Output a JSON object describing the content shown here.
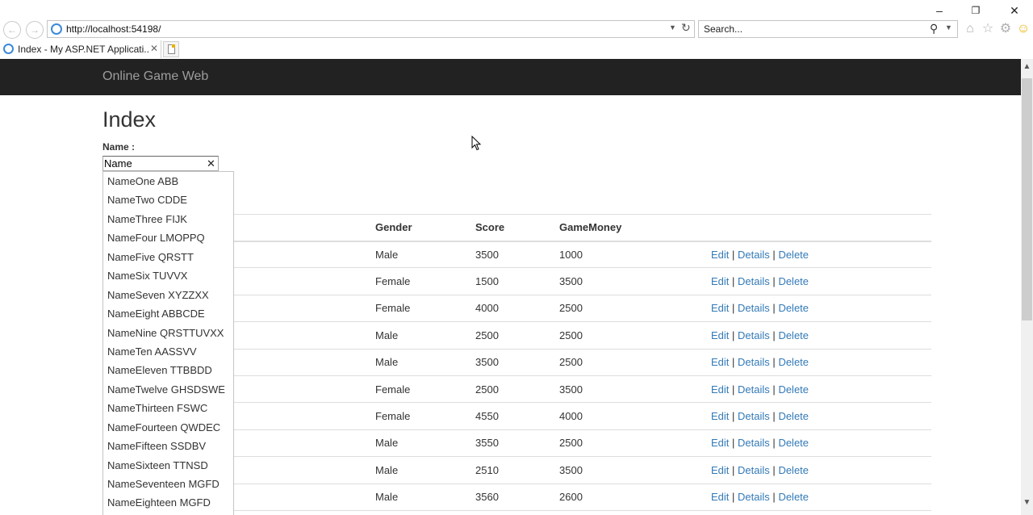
{
  "browser": {
    "url": "http://localhost:54198/",
    "search_placeholder": "Search...",
    "tab_title": "Index - My ASP.NET Applicati...",
    "window_controls": [
      "minimize-icon",
      "restore-icon",
      "close-icon"
    ],
    "toolbar_icons": [
      "home-icon",
      "favorites-star-icon",
      "settings-gear-icon",
      "feedback-smiley-icon"
    ]
  },
  "site": {
    "brand": "Online Game Web"
  },
  "page": {
    "title": "Index",
    "name_label": "Name :",
    "name_value": "Name"
  },
  "autocomplete": [
    "NameOne ABB",
    "NameTwo CDDE",
    "NameThree FIJK",
    "NameFour LMOPPQ",
    "NameFive QRSTT",
    "NameSix TUVVX",
    "NameSeven XYZZXX",
    "NameEight ABBCDE",
    "NameNine QRSTTUVXX",
    "NameTen AASSVV",
    "NameEleven TTBBDD",
    "NameTwelve GHSDSWE",
    "NameThirteen FSWC",
    "NameFourteen QWDEC",
    "NameFifteen SSDBV",
    "NameSixteen TTNSD",
    "NameSeventeen MGFD",
    "NameEighteen MGFD"
  ],
  "table": {
    "headers": [
      "",
      "Gender",
      "Score",
      "GameMoney",
      ""
    ],
    "actions": {
      "edit": "Edit",
      "details": "Details",
      "delete": "Delete",
      "separator": "|"
    },
    "rows": [
      {
        "gender": "Male",
        "score": "3500",
        "money": "1000"
      },
      {
        "gender": "Female",
        "score": "1500",
        "money": "3500"
      },
      {
        "gender": "Female",
        "score": "4000",
        "money": "2500"
      },
      {
        "gender": "Male",
        "score": "2500",
        "money": "2500"
      },
      {
        "gender": "Male",
        "score": "3500",
        "money": "2500"
      },
      {
        "gender": "Female",
        "score": "2500",
        "money": "3500"
      },
      {
        "gender": "Female",
        "score": "4550",
        "money": "4000"
      },
      {
        "gender": "Male",
        "score": "3550",
        "money": "2500"
      },
      {
        "gender": "Male",
        "score": "2510",
        "money": "3500"
      },
      {
        "gender": "Male",
        "score": "3560",
        "money": "2600"
      }
    ]
  },
  "colors": {
    "navbar_bg": "#222222",
    "brand_text": "#9d9d9d",
    "link": "#337ab7"
  }
}
